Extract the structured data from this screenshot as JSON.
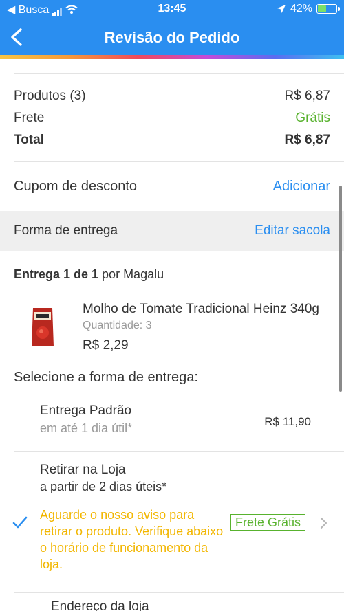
{
  "status_bar": {
    "back_app": "◀ Busca",
    "time": "13:45",
    "battery": "42%",
    "battery_level": 0.42,
    "location_arrow": "location-arrow"
  },
  "header": {
    "title": "Revisão do Pedido",
    "back_icon": "chevron-left"
  },
  "colors": {
    "header_bg": "#2a8ef0",
    "accent_blue": "#2a8ef0",
    "success_green": "#58b22e",
    "warning_yellow": "#f2b600",
    "section_bg": "#efefef"
  },
  "summary": {
    "products_label": "Produtos (3)",
    "products_value": "R$ 6,87",
    "shipping_label": "Frete",
    "shipping_value": "Grátis",
    "total_label": "Total",
    "total_value": "R$ 6,87"
  },
  "coupon": {
    "label": "Cupom de desconto",
    "action": "Adicionar"
  },
  "delivery_section": {
    "title": "Forma de entrega",
    "action": "Editar sacola"
  },
  "shipment": {
    "label_bold": "Entrega 1 de 1",
    "label_rest": " por Magalu"
  },
  "product": {
    "name": "Molho de Tomate Tradicional Heinz 340g",
    "quantity": "Quantidade: 3",
    "price": "R$ 2,29"
  },
  "select_title": "Selecione a forma de entrega:",
  "options": {
    "standard_title": "Entrega Padrão",
    "standard_sub": "em até 1 dia útil*",
    "standard_price": "R$ 11,90",
    "pickup_title": "Retirar na Loja",
    "pickup_sub": "a partir de 2 dias úteis*",
    "pickup_notice": "Aguarde o nosso aviso para retirar o produto. Verifique abaixo o horário de funcionamento da loja.",
    "pickup_badge": "Frete Grátis",
    "store_address_label": "Endereço da loja"
  }
}
